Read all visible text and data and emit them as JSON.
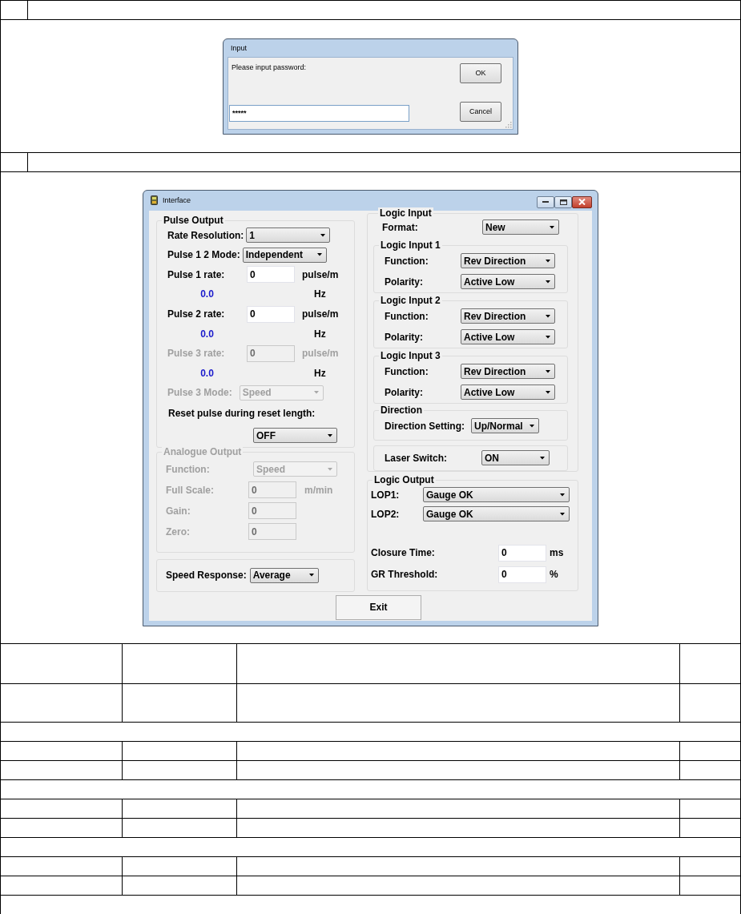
{
  "input_dialog": {
    "title": "Input",
    "prompt": "Please input password:",
    "password": {
      "value": "*****"
    },
    "buttons": [
      {
        "label": "OK"
      },
      {
        "label": "Cancel"
      }
    ]
  },
  "interface_dialog": {
    "title": "Interface",
    "pulse_output": {
      "title": "Pulse Output",
      "rows": [
        {
          "kind": "dropdown",
          "label": "Rate Resolution:",
          "value": "1",
          "disabled": false
        },
        {
          "kind": "dropdown",
          "label": "Pulse 1 2 Mode:",
          "value": "Independent",
          "disabled": false
        },
        {
          "kind": "field",
          "label": "Pulse 1 rate:",
          "value": "0",
          "unit": "pulse/m",
          "disabled": false
        },
        {
          "kind": "reading",
          "value": "0.0",
          "unit": "Hz"
        },
        {
          "kind": "field",
          "label": "Pulse 2 rate:",
          "value": "0",
          "unit": "pulse/m",
          "disabled": false
        },
        {
          "kind": "reading",
          "value": "0.0",
          "unit": "Hz"
        },
        {
          "kind": "field",
          "label": "Pulse 3 rate:",
          "value": "0",
          "unit": "pulse/m",
          "disabled": true
        },
        {
          "kind": "reading",
          "value": "0.0",
          "unit": "Hz"
        },
        {
          "kind": "dropdown",
          "label": "Pulse 3 Mode:",
          "value": "Speed",
          "disabled": true
        },
        {
          "kind": "heading",
          "label": "Reset pulse during reset length:"
        },
        {
          "kind": "dropdown",
          "value": "OFF",
          "disabled": false
        }
      ]
    },
    "analogue_output": {
      "title": "Analogue Output",
      "disabled": true,
      "rows": [
        {
          "kind": "dropdown",
          "label": "Function:",
          "value": "Speed",
          "disabled": true
        },
        {
          "kind": "field",
          "label": "Full Scale:",
          "value": "0",
          "unit": "m/min",
          "disabled": true
        },
        {
          "kind": "field",
          "label": "Gain:",
          "value": "0",
          "disabled": true
        },
        {
          "kind": "field",
          "label": "Zero:",
          "value": "0",
          "disabled": true
        }
      ]
    },
    "speed_response": {
      "kind": "dropdown",
      "label": "Speed Response:",
      "value": "Average",
      "disabled": false
    },
    "logic_input": {
      "title": "Logic Input",
      "format": {
        "kind": "dropdown",
        "label": "Format:",
        "value": "New",
        "disabled": false
      },
      "groups": [
        {
          "title": "Logic Input 1",
          "rows": [
            {
              "kind": "dropdown",
              "label": "Function:",
              "value": "Rev Direction",
              "disabled": false
            },
            {
              "kind": "dropdown",
              "label": "Polarity:",
              "value": "Active Low",
              "disabled": false
            }
          ]
        },
        {
          "title": "Logic Input 2",
          "rows": [
            {
              "kind": "dropdown",
              "label": "Function:",
              "value": "Rev Direction",
              "disabled": false
            },
            {
              "kind": "dropdown",
              "label": "Polarity:",
              "value": "Active Low",
              "disabled": false
            }
          ]
        },
        {
          "title": "Logic Input 3",
          "rows": [
            {
              "kind": "dropdown",
              "label": "Function:",
              "value": "Rev Direction",
              "disabled": false
            },
            {
              "kind": "dropdown",
              "label": "Polarity:",
              "value": "Active Low",
              "disabled": false
            }
          ]
        }
      ],
      "direction": {
        "title": "Direction",
        "rows": [
          {
            "kind": "dropdown",
            "label": "Direction Setting:",
            "value": "Up/Normal",
            "disabled": false
          }
        ]
      },
      "laser": {
        "rows": [
          {
            "kind": "dropdown",
            "label": "Laser Switch:",
            "value": "ON",
            "disabled": false
          }
        ]
      }
    },
    "logic_output": {
      "title": "Logic Output",
      "rows": [
        {
          "kind": "dropdown",
          "label": "LOP1:",
          "value": "Gauge OK",
          "disabled": false
        },
        {
          "kind": "dropdown",
          "label": "LOP2:",
          "value": "Gauge OK",
          "disabled": false
        },
        {
          "kind": "field",
          "label": "Closure Time:",
          "value": "0",
          "unit": "ms",
          "disabled": false
        },
        {
          "kind": "field",
          "label": "GR Threshold:",
          "value": "0",
          "unit": "%",
          "disabled": false
        }
      ]
    },
    "exit_button": {
      "label": "Exit"
    }
  }
}
